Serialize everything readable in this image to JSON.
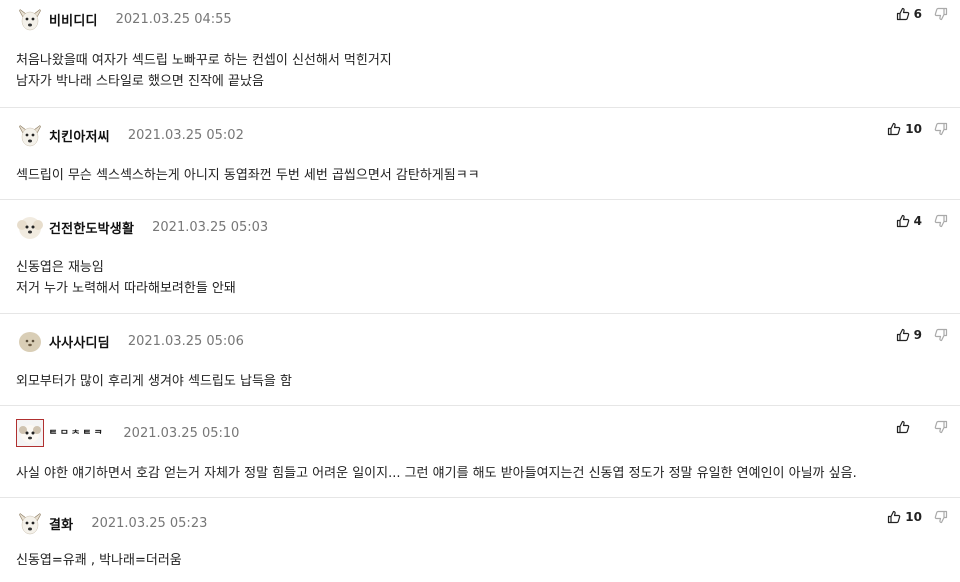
{
  "comments": [
    {
      "nickname": "비비디디",
      "date": "2021.03.25 04:55",
      "lines": [
        "처음나왔을때 여자가 섹드립 노빠꾸로 하는 컨셉이 신선해서 먹힌거지",
        "남자가 박나래 스타일로 했으면 진작에 끝났음"
      ],
      "likes": "6",
      "avatar": "dog-white"
    },
    {
      "nickname": "치킨아저씨",
      "date": "2021.03.25 05:02",
      "lines": [
        "섹드립이 무슨 섹스섹스하는게 아니지 동엽좌껀 두번 세번 곱씹으면서 감탄하게됨ㅋㅋ"
      ],
      "likes": "10",
      "avatar": "dog-white"
    },
    {
      "nickname": "건전한도박생활",
      "date": "2021.03.25 05:03",
      "lines": [
        "신동엽은 재능임",
        "저거 누가 노력해서 따라해보려한들 안돼"
      ],
      "likes": "4",
      "avatar": "puppy-fluffy"
    },
    {
      "nickname": "사사사디딤",
      "date": "2021.03.25 05:06",
      "lines": [
        "외모부터가 많이 후리게 생겨야 섹드립도 납득을 함"
      ],
      "likes": "9",
      "avatar": "puppy-beige"
    },
    {
      "nickname": "ᄐᄆᄎᄐᄏ",
      "date": "2021.03.25 05:10",
      "lines": [
        "사실 야한 얘기하면서 호감 얻는거 자체가 정말 힘들고 어려운 일이지... 그런 얘기를 해도 받아들여지는건 신동엽 정도가 정말 유일한 연예인이 아닐까 싶음."
      ],
      "likes": "",
      "avatar": "puppy-framed"
    },
    {
      "nickname": "결화",
      "date": "2021.03.25 05:23",
      "lines": [
        "신동엽=유쾌 , 박나래=더러움"
      ],
      "likes": "10",
      "avatar": "dog-white"
    }
  ]
}
